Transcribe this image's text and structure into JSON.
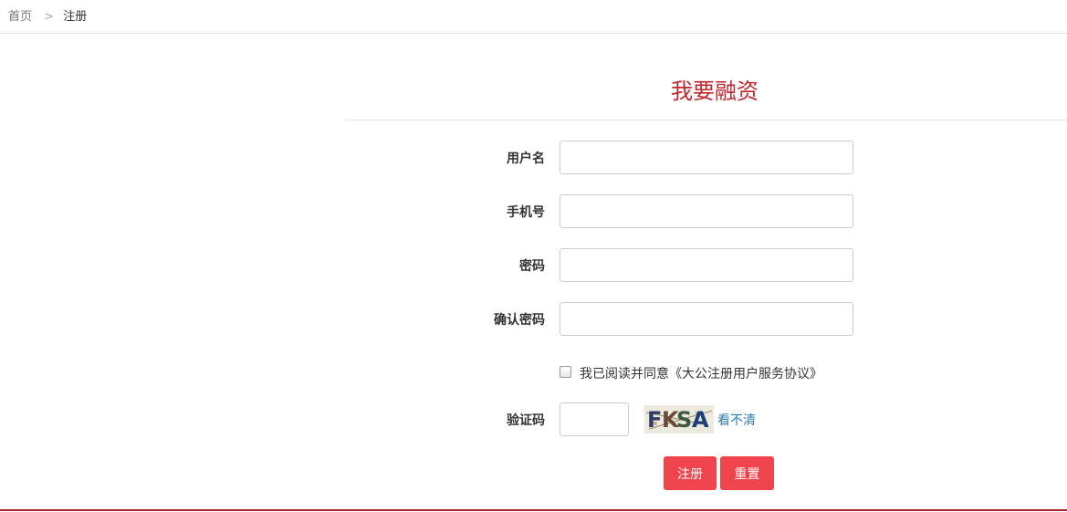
{
  "breadcrumb": {
    "home": "首页",
    "separator": ">",
    "current": "注册"
  },
  "title": "我要融资",
  "form": {
    "username_label": "用户名",
    "username_value": "",
    "phone_label": "手机号",
    "phone_value": "",
    "password_label": "密码",
    "password_value": "",
    "confirm_password_label": "确认密码",
    "confirm_password_value": "",
    "agreement_text": "我已阅读并同意《大公注册用户服务协议》",
    "agreement_checked": false,
    "captcha_label": "验证码",
    "captcha_value": "",
    "captcha_image_text": "FKSA",
    "captcha_refresh": "看不清",
    "register_button": "注册",
    "reset_button": "重置"
  },
  "colors": {
    "accent": "#c0272d",
    "button": "#f0444d",
    "link": "#2b7bb5",
    "footer_line": "#a6232c"
  }
}
